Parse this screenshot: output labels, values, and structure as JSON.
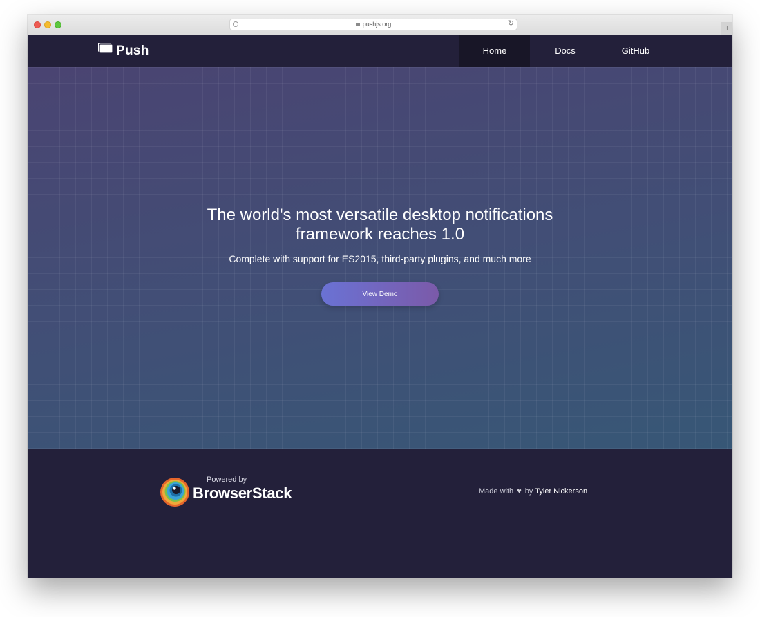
{
  "browser": {
    "url": "pushjs.org",
    "new_tab_symbol": "+",
    "reload_symbol": "↻"
  },
  "navbar": {
    "brand": "Push",
    "links": [
      {
        "label": "Home",
        "active": true
      },
      {
        "label": "Docs",
        "active": false
      },
      {
        "label": "GitHub",
        "active": false
      }
    ]
  },
  "hero": {
    "headline_line1": "The world's most versatile desktop notifications",
    "headline_line2": "framework reaches 1.0",
    "subheadline": "Complete with support for ES2015, third-party plugins, and much more",
    "cta_label": "View Demo"
  },
  "footer": {
    "powered_by": "Powered by",
    "sponsor_name": "BrowserStack",
    "made_with_prefix": "Made with",
    "heart_icon": "♥",
    "made_with_by": "by",
    "author": "Tyler Nickerson"
  },
  "colors": {
    "navbar_bg": "#23203a",
    "active_nav_bg": "#181627",
    "hero_gradient_start": "#4a4472",
    "hero_gradient_end": "#375776",
    "cta_gradient_start": "#6a72d4",
    "cta_gradient_end": "#7b5aa9"
  }
}
